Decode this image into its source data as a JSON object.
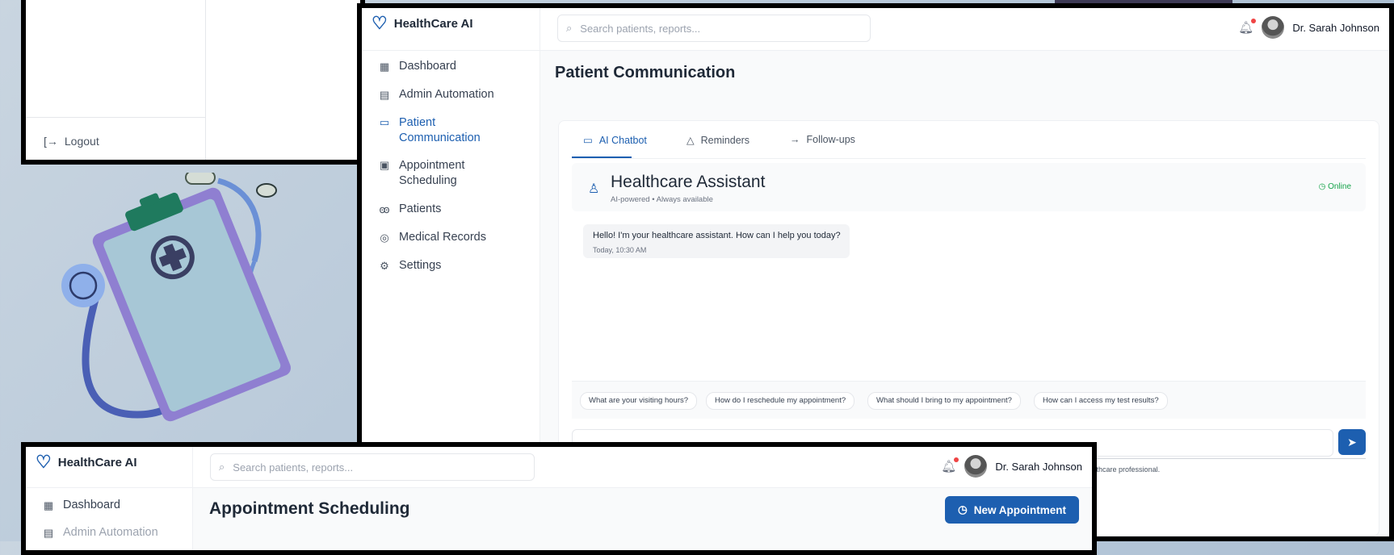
{
  "app": {
    "brand": "HealthCare AI",
    "search_placeholder": "Search patients, reports...",
    "user_name": "Dr. Sarah Johnson"
  },
  "top_left_fragment": {
    "logout_label": "Logout"
  },
  "main_panel": {
    "sidebar": {
      "items": [
        {
          "label": "Dashboard",
          "icon": "grid-icon"
        },
        {
          "label": "Admin Automation",
          "icon": "document-icon"
        },
        {
          "label": "Patient\nCommunication",
          "icon": "chat-icon",
          "active": true
        },
        {
          "label": "Appointment\nScheduling",
          "icon": "calendar-icon"
        },
        {
          "label": "Patients",
          "icon": "users-icon"
        },
        {
          "label": "Medical Records",
          "icon": "records-icon"
        },
        {
          "label": "Settings",
          "icon": "gear-icon"
        }
      ]
    },
    "page_title": "Patient Communication",
    "tabs": [
      {
        "label": "AI Chatbot",
        "icon": "chat-icon",
        "active": true
      },
      {
        "label": "Reminders",
        "icon": "bell-icon"
      },
      {
        "label": "Follow-ups",
        "icon": "arrow-right-icon"
      }
    ],
    "assistant": {
      "title": "Healthcare Assistant",
      "subtitle": "AI-powered • Always available",
      "status": "Online"
    },
    "message": {
      "text": "Hello! I'm your healthcare assistant. How can I help you today?",
      "time": "Today, 10:30 AM"
    },
    "quick_replies": [
      "What are your visiting hours?",
      "How do I reschedule my appointment?",
      "What should I bring to my appointment?",
      "How can I access my test results?"
    ],
    "disclaimer_fragment": "sult with a healthcare professional."
  },
  "bottom_panel": {
    "sidebar": {
      "items": [
        {
          "label": "Dashboard",
          "icon": "grid-icon"
        },
        {
          "label": "Admin Automation",
          "icon": "document-icon"
        }
      ]
    },
    "page_title": "Appointment Scheduling",
    "new_appointment_label": "New Appointment"
  },
  "colors": {
    "accent": "#1d5fb0",
    "online": "#16a34a",
    "background_gradient": [
      "#c9d5e0",
      "#9fb3c8"
    ],
    "illustration_purple": "#8f7fd1",
    "illustration_board": "#a7c7d6"
  }
}
